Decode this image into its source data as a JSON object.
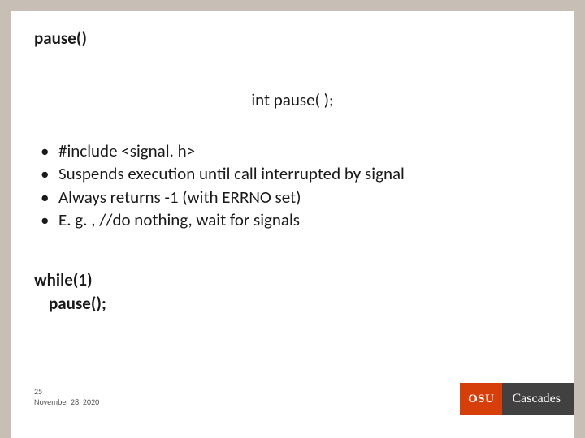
{
  "title": "pause()",
  "signature": "int pause( );",
  "bullets": [
    "#include <signal. h>",
    "Suspends execution until call interrupted by signal",
    "Always returns -1 (with ERRNO set)",
    "E. g. , //do nothing, wait for signals"
  ],
  "code": {
    "line1": "while(1)",
    "line2": "pause();"
  },
  "footer": {
    "page": "25",
    "date": "November 28, 2020"
  },
  "logo": {
    "left": "OSU",
    "right": "Cascades"
  }
}
